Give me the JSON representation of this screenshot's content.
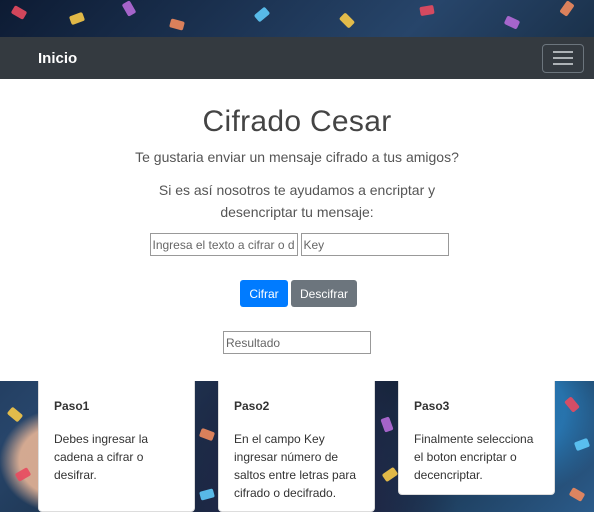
{
  "navbar": {
    "brand": "Inicio"
  },
  "hero": {
    "title": "Cifrado Cesar",
    "subtitle": "Te gustaria enviar un mensaje cifrado a tus amigos?",
    "description": "Si es así nosotros te ayudamos a encriptar y desencriptar tu mensaje:"
  },
  "form": {
    "text_placeholder": "Ingresa el texto a cifrar o decifrar",
    "key_placeholder": "Key",
    "encrypt_label": "Cifrar",
    "decrypt_label": "Descifrar",
    "result_placeholder": "Resultado"
  },
  "steps": [
    {
      "title": "Paso1",
      "text": "Debes ingresar la cadena a cifrar o desifrar."
    },
    {
      "title": "Paso2",
      "text": "En el campo Key ingresar número de saltos entre letras para cifrado o decifrado."
    },
    {
      "title": "Paso3",
      "text": "Finalmente selecciona el boton encriptar o decencriptar."
    }
  ],
  "colors": {
    "navbar": "#343a40",
    "primary": "#007bff",
    "secondary": "#6c757d"
  }
}
